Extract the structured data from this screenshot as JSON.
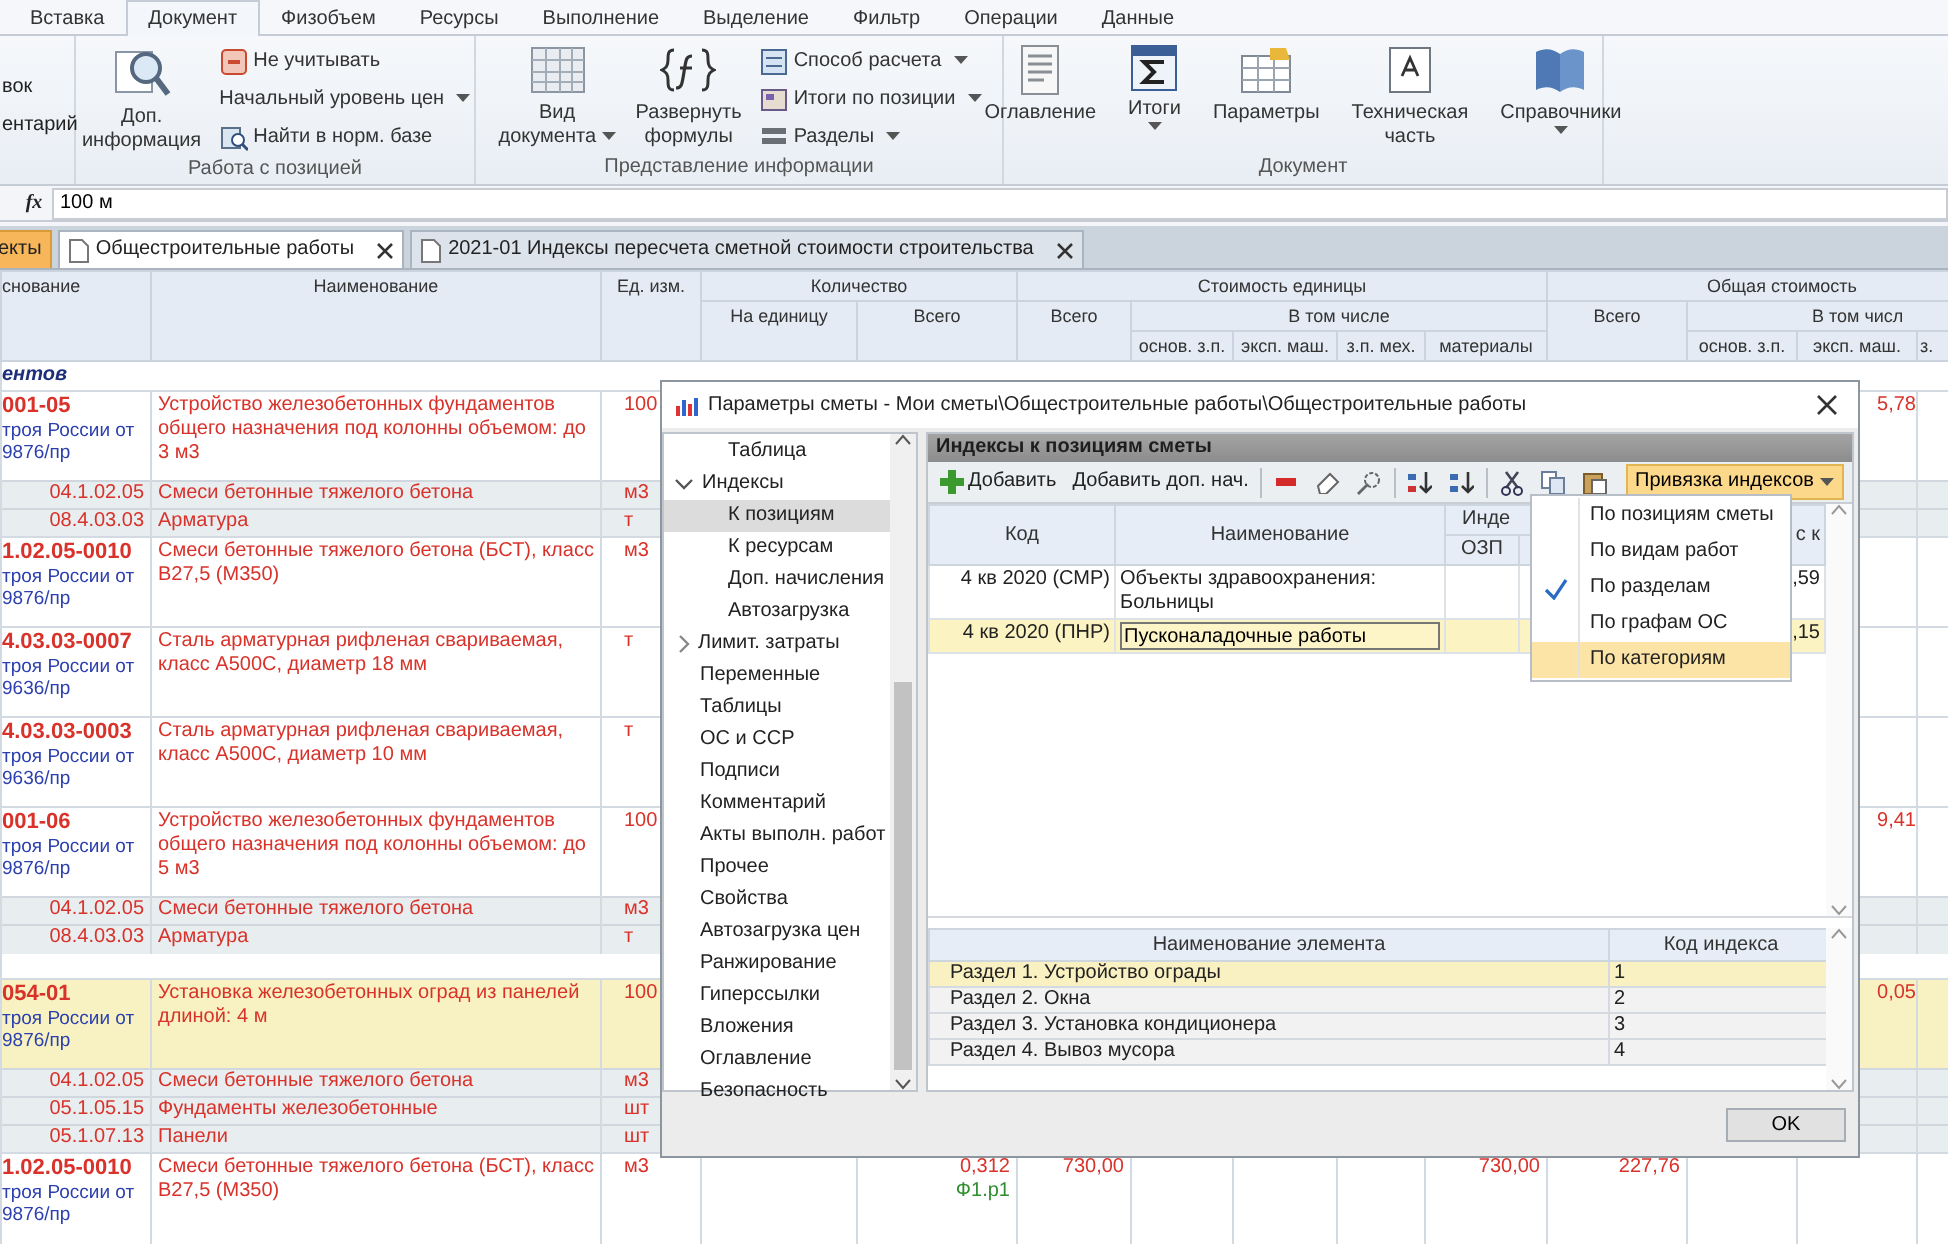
{
  "ribbon": {
    "tabs": [
      {
        "label": "Вставка",
        "selected": false
      },
      {
        "label": "Документ",
        "selected": true
      },
      {
        "label": "Физобъем",
        "selected": false
      },
      {
        "label": "Ресурсы",
        "selected": false
      },
      {
        "label": "Выполнение",
        "selected": false
      },
      {
        "label": "Выделение",
        "selected": false
      },
      {
        "label": "Фильтр",
        "selected": false
      },
      {
        "label": "Операции",
        "selected": false
      },
      {
        "label": "Данные",
        "selected": false
      }
    ],
    "cut_group": {
      "items": [
        "вок",
        "ентарий"
      ]
    },
    "groups": [
      {
        "label": "Работа с позицией",
        "items": [
          {
            "kind": "large",
            "lines": [
              "Доп.",
              "информация"
            ],
            "dropdown": false
          },
          {
            "kind": "small",
            "label": "Не учитывать",
            "icon": true,
            "dropdown": false
          },
          {
            "kind": "small",
            "label": "Начальный уровень цен",
            "icon": false,
            "dropdown": true
          },
          {
            "kind": "small",
            "label": "Найти в норм. базе",
            "icon": true,
            "dropdown": false
          }
        ]
      },
      {
        "label": "Представление информации",
        "items": [
          {
            "kind": "large",
            "lines": [
              "Вид",
              "документа"
            ],
            "dropdown": true
          },
          {
            "kind": "large",
            "lines": [
              "Развернуть",
              "формулы"
            ],
            "dropdown": false
          },
          {
            "kind": "small",
            "label": "Способ расчета",
            "icon": true,
            "dropdown": true
          },
          {
            "kind": "small",
            "label": "Итоги по позиции",
            "icon": true,
            "dropdown": true
          },
          {
            "kind": "small",
            "label": "Разделы",
            "icon": true,
            "dropdown": true
          }
        ]
      },
      {
        "label": "Документ",
        "items": [
          {
            "kind": "large",
            "lines": [
              "Оглавление"
            ],
            "dropdown": false
          },
          {
            "kind": "large",
            "lines": [
              "Итоги"
            ],
            "dropdown": true
          },
          {
            "kind": "large",
            "lines": [
              "Параметры"
            ],
            "dropdown": false
          },
          {
            "kind": "large",
            "lines": [
              "Техническая",
              "часть"
            ],
            "dropdown": false
          },
          {
            "kind": "large",
            "lines": [
              "Справочники"
            ],
            "dropdown": true
          }
        ]
      }
    ]
  },
  "formula_bar": {
    "label": "fx",
    "value": "100 м"
  },
  "doc_tabs": [
    {
      "label": "екты",
      "kind": "navigator",
      "selected": false,
      "closable": false
    },
    {
      "label": "Общестроительные работы",
      "kind": "document",
      "selected": true,
      "closable": true
    },
    {
      "label": "2021-01 Индексы пересчета сметной стоимости строительства",
      "kind": "document",
      "selected": false,
      "closable": true
    }
  ],
  "sheet": {
    "header": {
      "code": "снование",
      "name": "Наименование",
      "unit": "Ед. изм.",
      "quantity": {
        "label": "Количество",
        "per_unit": "На единицу",
        "total": "Всего"
      },
      "unit_cost": {
        "label": "Стоимость единицы",
        "total": "Всего",
        "including": "В том числе",
        "parts": [
          "основ. з.п.",
          "эксп. маш.",
          "з.п. мех.",
          "материалы"
        ]
      },
      "total_cost": {
        "label": "Общая стоимость",
        "total": "Всего",
        "including": "В том числ",
        "parts": [
          "основ. з.п.",
          "эксп. маш.",
          "з."
        ]
      }
    },
    "rows": [
      {
        "kind": "section",
        "name": "ентов"
      },
      {
        "kind": "position",
        "code": "001-05",
        "basis": "троя России от\n9876/пр",
        "name": "Устройство железобетонных фундаментов общего назначения под колонны объемом: до 3 м3",
        "unit": "100",
        "highlighted": false,
        "values": {
          "total_machines": "5,78"
        }
      },
      {
        "kind": "resource",
        "code": "04.1.02.05",
        "name": "Смеси бетонные тяжелого бетона",
        "unit": "м3"
      },
      {
        "kind": "resource",
        "code": "08.4.03.03",
        "name": "Арматура",
        "unit": "т"
      },
      {
        "kind": "position",
        "code": "1.02.05-0010",
        "basis": "троя России от\n9876/пр",
        "name": "Смеси бетонные тяжелого бетона (БСТ), класс В27,5 (М350)",
        "unit": "м3",
        "highlighted": false,
        "values": {}
      },
      {
        "kind": "position",
        "code": "4.03.03-0007",
        "basis": "троя России от\n9636/пр",
        "name": "Сталь арматурная рифленая свариваемая, класс А500С, диаметр 18 мм",
        "unit": "т",
        "highlighted": false,
        "values": {}
      },
      {
        "kind": "position",
        "code": "4.03.03-0003",
        "basis": "троя России от\n9636/пр",
        "name": "Сталь арматурная рифленая свариваемая, класс А500С, диаметр 10 мм",
        "unit": "т",
        "highlighted": false,
        "values": {}
      },
      {
        "kind": "position",
        "code": "001-06",
        "basis": "троя России от\n9876/пр",
        "name": "Устройство железобетонных фундаментов общего назначения под колонны объемом: до 5 м3",
        "unit": "100",
        "highlighted": false,
        "values": {
          "total_machines": "9,41"
        }
      },
      {
        "kind": "resource",
        "code": "04.1.02.05",
        "name": "Смеси бетонные тяжелого бетона",
        "unit": "м3"
      },
      {
        "kind": "resource",
        "code": "08.4.03.03",
        "name": "Арматура",
        "unit": "т"
      },
      {
        "kind": "gap"
      },
      {
        "kind": "position",
        "code": "054-01",
        "basis": "троя России от\n9876/пр",
        "name": "Установка железобетонных оград из панелей длиной: 4 м",
        "unit": "100",
        "highlighted": true,
        "values": {
          "total_machines": "0,05"
        }
      },
      {
        "kind": "resource",
        "code": "04.1.02.05",
        "name": "Смеси бетонные тяжелого бетона",
        "unit": "м3"
      },
      {
        "kind": "resource",
        "code": "05.1.05.15",
        "name": "Фундаменты железобетонные",
        "unit": "шт"
      },
      {
        "kind": "resource",
        "code": "05.1.07.13",
        "name": "Панели",
        "unit": "шт"
      },
      {
        "kind": "position",
        "code": "1.02.05-0010",
        "basis": "троя России от\n9876/пр",
        "name": "Смеси бетонные тяжелого бетона (БСТ), класс В27,5 (М350)",
        "unit": "м3",
        "highlighted": false,
        "values": {
          "qty_total": "0,312",
          "cost_total": "730,00",
          "cost_materials": "730,00",
          "total": "227,76"
        },
        "qty_note": "Ф1.р1"
      }
    ]
  },
  "dialog": {
    "title": "Параметры сметы - Мои сметы\\Общестроительные работы\\Общестроительные работы",
    "nav": [
      {
        "children": [
          {
            "label": "Таблица",
            "selected": false
          }
        ]
      },
      {
        "label": "Индексы",
        "expanded": true,
        "selected": false,
        "children": [
          {
            "label": "К позициям",
            "selected": true
          },
          {
            "label": "К ресурсам",
            "selected": false
          },
          {
            "label": "Доп. начисления",
            "selected": false
          },
          {
            "label": "Автозагрузка",
            "selected": false
          }
        ]
      },
      {
        "label": "Лимит. затраты",
        "expanded": false,
        "selected": false
      },
      {
        "label": "Переменные",
        "selected": false
      },
      {
        "label": "Таблицы",
        "selected": false
      },
      {
        "label": "ОС и ССР",
        "selected": false
      },
      {
        "label": "Подписи",
        "selected": false
      },
      {
        "label": "Комментарий",
        "selected": false
      },
      {
        "label": "Акты выполн. работ",
        "selected": false
      },
      {
        "label": "Прочее",
        "selected": false
      },
      {
        "label": "Свойства",
        "selected": false
      },
      {
        "label": "Автозагрузка цен",
        "selected": false
      },
      {
        "label": "Ранжирование",
        "selected": false
      },
      {
        "label": "Гиперссылки",
        "selected": false
      },
      {
        "label": "Вложения",
        "selected": false
      },
      {
        "label": "Оглавление",
        "selected": false
      },
      {
        "label": "Безопасность",
        "selected": false
      }
    ],
    "panel_title": "Индексы к позициям сметы",
    "toolbar": [
      {
        "kind": "button",
        "label": "Добавить",
        "icon": true
      },
      {
        "kind": "button",
        "label": "Добавить доп. нач.",
        "icon": false
      },
      {
        "kind": "separator"
      },
      {
        "kind": "icon"
      },
      {
        "kind": "icon"
      },
      {
        "kind": "icon"
      },
      {
        "kind": "separator"
      },
      {
        "kind": "icon"
      },
      {
        "kind": "icon"
      },
      {
        "kind": "separator"
      },
      {
        "kind": "icon"
      },
      {
        "kind": "icon"
      },
      {
        "kind": "icon"
      },
      {
        "kind": "menu",
        "label": "Привязка индексов",
        "open": true
      }
    ],
    "index_table": {
      "columns": {
        "code": "Код",
        "name": "Наименование",
        "indexes": "Инде",
        "ozp": "ОЗП",
        "last": "с к"
      },
      "rows": [
        {
          "code": "4 кв 2020 (СМР)",
          "name": "Объекты здравоохранения: Больницы",
          "last": ",59",
          "selected": false,
          "editing": false
        },
        {
          "code": "4 кв 2020 (ПНР)",
          "name": "Пусконаладочные работы",
          "last": ",15",
          "selected": true,
          "editing": true
        }
      ]
    },
    "menu": [
      {
        "label": "По позициям сметы",
        "checked": false,
        "selected": false
      },
      {
        "label": "По видам работ",
        "checked": false,
        "selected": false
      },
      {
        "label": "По разделам",
        "checked": true,
        "selected": false
      },
      {
        "label": "По графам ОС",
        "checked": false,
        "selected": false
      },
      {
        "label": "По категориям",
        "checked": false,
        "selected": true
      }
    ],
    "element_table": {
      "columns": [
        "Наименование элемента",
        "Код индекса"
      ],
      "rows": [
        {
          "name": "Раздел 1. Устройство ограды",
          "code": "1",
          "selected": true
        },
        {
          "name": "Раздел 2. Окна",
          "code": "2",
          "selected": false
        },
        {
          "name": "Раздел 3. Установка кондиционера",
          "code": "3",
          "selected": false
        },
        {
          "name": "Раздел 4. Вывоз мусора",
          "code": "4",
          "selected": false
        }
      ]
    },
    "ok": "OK"
  }
}
